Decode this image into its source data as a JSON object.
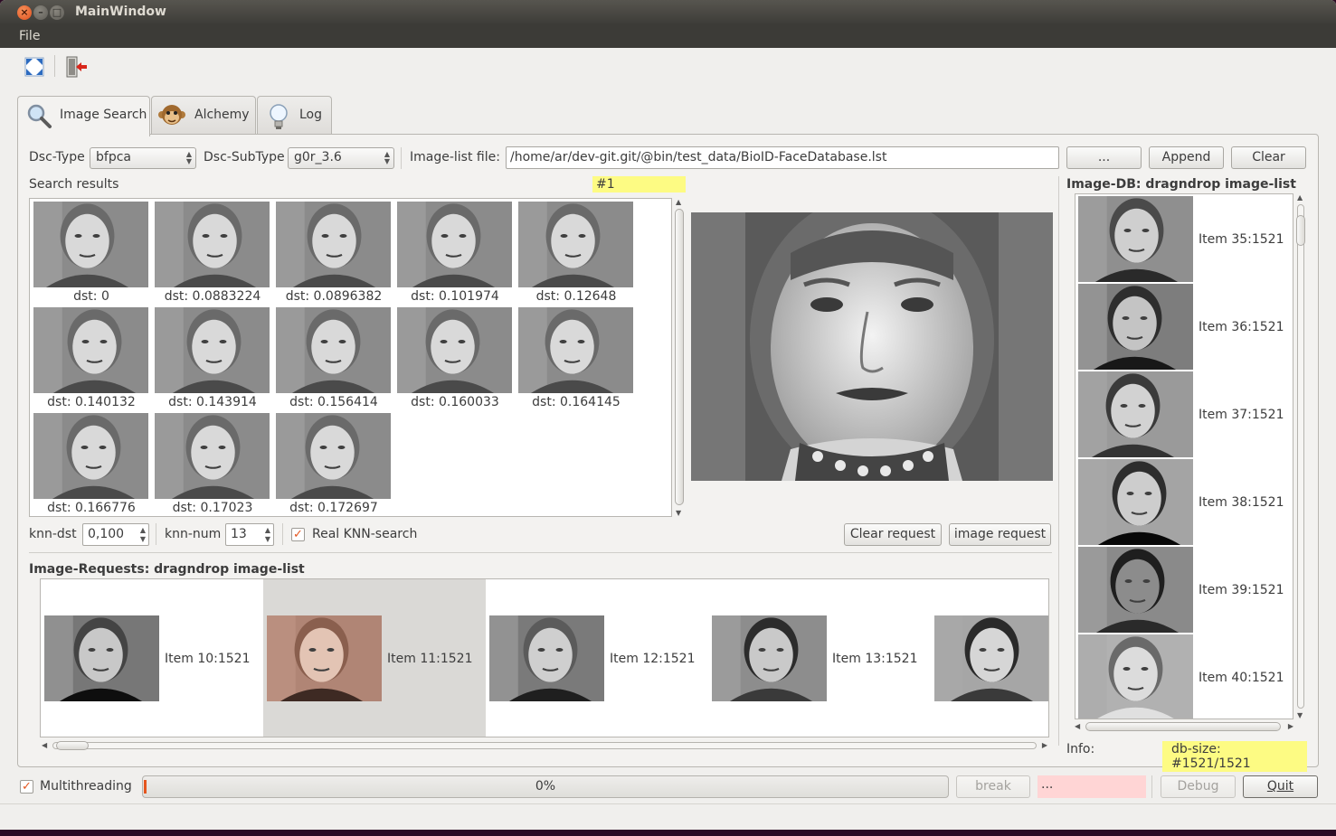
{
  "window": {
    "title": "MainWindow"
  },
  "menu": {
    "file": "File"
  },
  "toolbar": {
    "fullscreen_icon": "fullscreen-icon",
    "exit_icon": "exit-icon"
  },
  "tabs": [
    {
      "label": "Image Search",
      "icon": "magnifier-icon",
      "active": true
    },
    {
      "label": "Alchemy",
      "icon": "monkey-icon",
      "active": false
    },
    {
      "label": "Log",
      "icon": "lightbulb-icon",
      "active": false
    }
  ],
  "controls": {
    "dsc_type_label": "Dsc-Type",
    "dsc_type_value": "bfpca",
    "dsc_subtype_label": "Dsc-SubType",
    "dsc_subtype_value": "g0r_3.6",
    "image_list_label": "Image-list file:",
    "image_list_value": "/home/ar/dev-git.git/@bin/test_data/BioID-FaceDatabase.lst",
    "browse_button": "...",
    "append_button": "Append",
    "clear_button": "Clear"
  },
  "search": {
    "label": "Search results",
    "selected_marker": "#1",
    "results": [
      {
        "dst": "dst: 0"
      },
      {
        "dst": "dst: 0.0883224"
      },
      {
        "dst": "dst: 0.0896382"
      },
      {
        "dst": "dst: 0.101974"
      },
      {
        "dst": "dst: 0.12648"
      },
      {
        "dst": "dst: 0.140132"
      },
      {
        "dst": "dst: 0.143914"
      },
      {
        "dst": "dst: 0.156414"
      },
      {
        "dst": "dst: 0.160033"
      },
      {
        "dst": "dst: 0.164145"
      },
      {
        "dst": "dst: 0.166776"
      },
      {
        "dst": "dst: 0.17023"
      },
      {
        "dst": "dst: 0.172697"
      }
    ]
  },
  "knn": {
    "dst_label": "knn-dst",
    "dst_value": "0,100",
    "num_label": "knn-num",
    "num_value": "13",
    "real_knn_label": "Real KNN-search",
    "real_knn_checked": true,
    "clear_request": "Clear request",
    "image_request": "image request"
  },
  "requests": {
    "label": "Image-Requests: dragndrop image-list",
    "items": [
      {
        "label": "Item 10:1521"
      },
      {
        "label": "Item 11:1521"
      },
      {
        "label": "Item 12:1521"
      },
      {
        "label": "Item 13:1521"
      },
      {
        "label": ""
      }
    ]
  },
  "db": {
    "label": "Image-DB: dragndrop image-list",
    "items": [
      {
        "label": "Item 35:1521"
      },
      {
        "label": "Item 36:1521"
      },
      {
        "label": "Item 37:1521"
      },
      {
        "label": "Item 38:1521"
      },
      {
        "label": "Item 39:1521"
      },
      {
        "label": "Item 40:1521"
      }
    ],
    "info_label": "Info:",
    "info_value": "db-size: #1521/1521"
  },
  "bottom": {
    "multithreading_label": "Multithreading",
    "multithreading_checked": true,
    "progress_text": "0%",
    "progress_value": 0.0,
    "break_button": "break",
    "status_text": "...",
    "debug_button": "Debug",
    "quit_button": "Quit"
  },
  "colors": {
    "accent": "#e5561f",
    "highlight": "#fdfb83",
    "status_error": "#ffd5d5"
  }
}
